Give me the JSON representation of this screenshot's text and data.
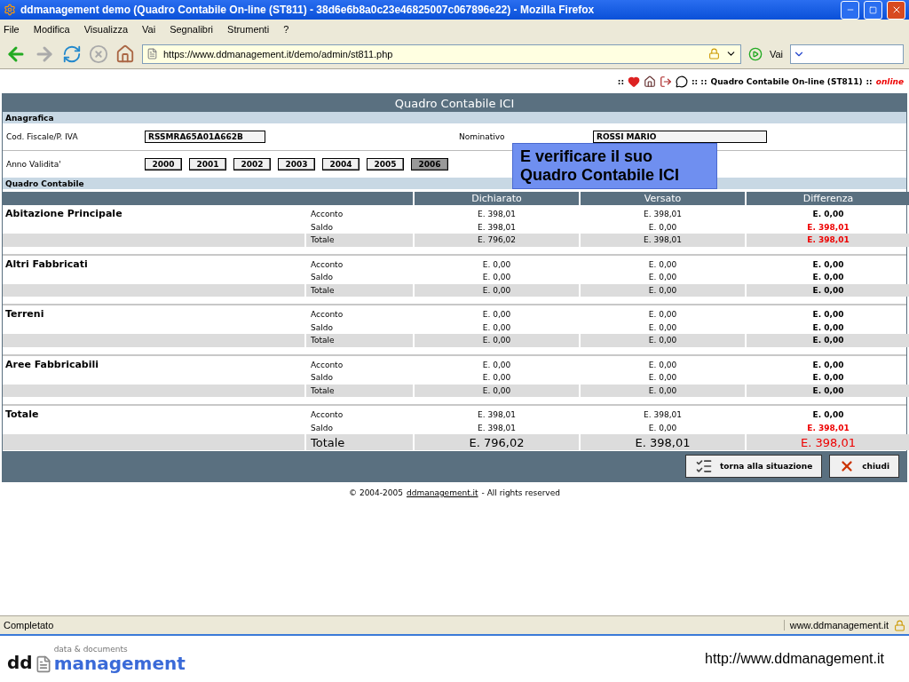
{
  "window": {
    "title": "ddmanagement demo (Quadro Contabile On-line (ST811) - 38d6e6b8a0c23e46825007c067896e22) - Mozilla Firefox"
  },
  "menu": [
    "File",
    "Modifica",
    "Visualizza",
    "Vai",
    "Segnalibri",
    "Strumenti",
    "?"
  ],
  "address": {
    "value": "https://www.ddmanagement.it/demo/admin/st811.php"
  },
  "go_label": "Vai",
  "topnav": {
    "separator_left": "::",
    "separator_mid": ":: ::",
    "title": "Quadro Contabile On-line (ST811)",
    "separator_right": "::",
    "status": "online"
  },
  "panel": {
    "title": "Quadro Contabile ICI",
    "anagrafica": {
      "heading": "Anagrafica",
      "cf_label": "Cod. Fiscale/P. IVA",
      "cf_value": "RSSMRA65A01A662B",
      "name_label": "Nominativo",
      "name_value": "ROSSI MARIO",
      "year_label": "Anno Validita'"
    },
    "years": [
      {
        "label": "2000",
        "selected": false
      },
      {
        "label": "2001",
        "selected": false
      },
      {
        "label": "2002",
        "selected": false
      },
      {
        "label": "2003",
        "selected": false
      },
      {
        "label": "2004",
        "selected": false
      },
      {
        "label": "2005",
        "selected": false
      },
      {
        "label": "2006",
        "selected": true
      }
    ],
    "section": "Quadro Contabile",
    "columns": [
      "Dichiarato",
      "Versato",
      "Differenza"
    ],
    "groups": [
      {
        "name": "Abitazione Principale",
        "rows": [
          {
            "kind": "line",
            "label": "Acconto",
            "dichiarato": "E. 398,01",
            "versato": "E. 398,01",
            "differenza": "E. 0,00",
            "alert": false
          },
          {
            "kind": "line",
            "label": "Saldo",
            "dichiarato": "E. 398,01",
            "versato": "E. 0,00",
            "differenza": "E. 398,01",
            "alert": true
          },
          {
            "kind": "total",
            "label": "Totale",
            "dichiarato": "E. 796,02",
            "versato": "E. 398,01",
            "differenza": "E. 398,01",
            "alert": true
          }
        ]
      },
      {
        "name": "Altri Fabbricati",
        "rows": [
          {
            "kind": "line",
            "label": "Acconto",
            "dichiarato": "E. 0,00",
            "versato": "E. 0,00",
            "differenza": "E. 0,00",
            "alert": false
          },
          {
            "kind": "line",
            "label": "Saldo",
            "dichiarato": "E. 0,00",
            "versato": "E. 0,00",
            "differenza": "E. 0,00",
            "alert": false
          },
          {
            "kind": "total",
            "label": "Totale",
            "dichiarato": "E. 0,00",
            "versato": "E. 0,00",
            "differenza": "E. 0,00",
            "alert": false
          }
        ]
      },
      {
        "name": "Terreni",
        "rows": [
          {
            "kind": "line",
            "label": "Acconto",
            "dichiarato": "E. 0,00",
            "versato": "E. 0,00",
            "differenza": "E. 0,00",
            "alert": false
          },
          {
            "kind": "line",
            "label": "Saldo",
            "dichiarato": "E. 0,00",
            "versato": "E. 0,00",
            "differenza": "E. 0,00",
            "alert": false
          },
          {
            "kind": "total",
            "label": "Totale",
            "dichiarato": "E. 0,00",
            "versato": "E. 0,00",
            "differenza": "E. 0,00",
            "alert": false
          }
        ]
      },
      {
        "name": "Aree Fabbricabili",
        "rows": [
          {
            "kind": "line",
            "label": "Acconto",
            "dichiarato": "E. 0,00",
            "versato": "E. 0,00",
            "differenza": "E. 0,00",
            "alert": false
          },
          {
            "kind": "line",
            "label": "Saldo",
            "dichiarato": "E. 0,00",
            "versato": "E. 0,00",
            "differenza": "E. 0,00",
            "alert": false
          },
          {
            "kind": "total",
            "label": "Totale",
            "dichiarato": "E. 0,00",
            "versato": "E. 0,00",
            "differenza": "E. 0,00",
            "alert": false
          }
        ]
      },
      {
        "name": "Totale",
        "rows": [
          {
            "kind": "line",
            "label": "Acconto",
            "dichiarato": "E. 398,01",
            "versato": "E. 398,01",
            "differenza": "E. 0,00",
            "alert": false
          },
          {
            "kind": "line",
            "label": "Saldo",
            "dichiarato": "E. 398,01",
            "versato": "E. 0,00",
            "differenza": "E. 398,01",
            "alert": true
          },
          {
            "kind": "grand",
            "label": "Totale",
            "dichiarato": "E. 796,02",
            "versato": "E. 398,01",
            "differenza": "E. 398,01",
            "alert": true
          }
        ]
      }
    ],
    "buttons": [
      {
        "kind": "list",
        "label": "torna alla situazione"
      },
      {
        "kind": "close",
        "label": "chiudi"
      }
    ]
  },
  "callout": "E verificare il suo Quadro Contabile ICI",
  "copyright": {
    "text": "© 2004-2005",
    "link": "ddmanagement.it",
    "suffix": "- All rights reserved"
  },
  "status_bar": {
    "text": "Completato",
    "site": "www.ddmanagement.it"
  },
  "slide_footer": {
    "logo_small": "data & documents",
    "logo_dd": "dd",
    "logo_main": "management",
    "url": "http://www.ddmanagement.it"
  }
}
